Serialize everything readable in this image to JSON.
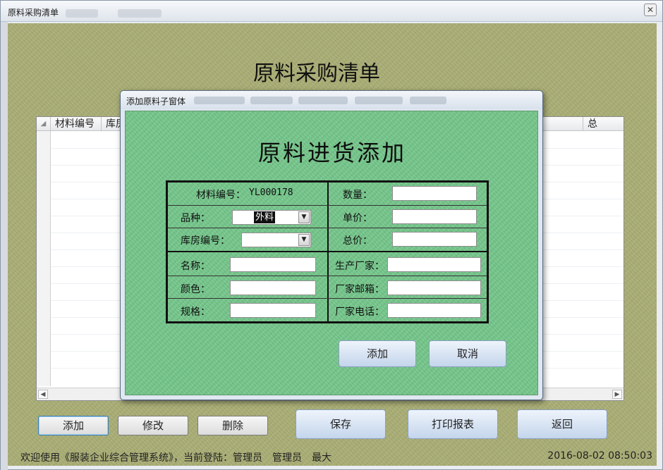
{
  "window": {
    "title": "原料采购清单",
    "close_glyph": "✕"
  },
  "form": {
    "heading": "原料采购清单",
    "grid": {
      "columns": [
        "材料编号",
        "库房"
      ],
      "right_partial_header": "总",
      "corner_glyph": "◢"
    },
    "buttons": {
      "add": "添加",
      "edit": "修改",
      "delete": "删除",
      "save": "保存",
      "print": "打印报表",
      "back": "返回"
    },
    "status": {
      "message": "欢迎使用《服装企业综合管理系统》，当前登陆：管理员　管理员　最大",
      "datetime": "2016-08-02 08:50:03"
    }
  },
  "dialog": {
    "title": "添加原料子窗体",
    "heading": "原料进货添加",
    "fields": {
      "material_no_label": "材料编号：",
      "material_no_value": "YL000178",
      "variety_label": "品种：",
      "variety_value": "外料",
      "warehouse_label": "库房编号：",
      "warehouse_value": "",
      "name_label": "名称：",
      "color_label": "颜色：",
      "spec_label": "规格：",
      "quantity_label": "数量：",
      "unit_price_label": "单价：",
      "total_price_label": "总价：",
      "manufacturer_label": "生产厂家：",
      "manufacturer_email_label": "厂家邮箱：",
      "manufacturer_phone_label": "厂家电话："
    },
    "buttons": {
      "add": "添加",
      "cancel": "取消"
    }
  },
  "icons": {
    "dropdown": "chevron-down-icon",
    "scroll_left": "scroll-left-icon",
    "scroll_right": "scroll-right-icon"
  },
  "colors": {
    "form_background": "#a9ad74",
    "dialog_background": "#74c68a",
    "button_blue": "#c4d5ec"
  }
}
